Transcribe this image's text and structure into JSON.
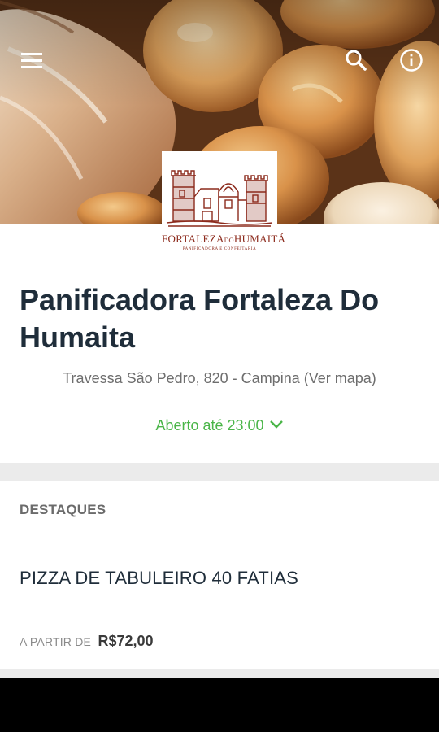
{
  "header": {
    "menu_icon": "menu-icon",
    "search_icon": "search-icon",
    "info_icon": "info-icon"
  },
  "logo": {
    "name_part1": "FORTALEZA",
    "name_part2": "DO",
    "name_part3": "HUMAITÁ",
    "tagline": "PANIFICADORA E CONFEITARIA",
    "color": "#8c2a1c"
  },
  "store": {
    "name": "Panificadora Fortaleza Do Humaita",
    "address": "Travessa São Pedro, 820 - Campina (Ver mapa)",
    "hours": "Aberto até 23:00",
    "hours_icon": "chevron-down-icon",
    "open_color": "#4ab548"
  },
  "highlights": {
    "title": "DESTAQUES",
    "items": [
      {
        "name": "PIZZA DE TABULEIRO 40 FATIAS",
        "price_prefix": "A PARTIR DE",
        "price": "R$72,00"
      }
    ]
  }
}
